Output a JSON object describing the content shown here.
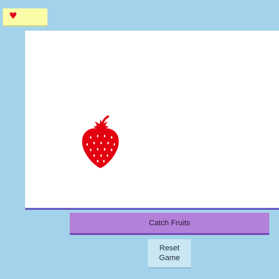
{
  "hud": {
    "lives_icon": "heart-icon",
    "lives_symbol": "♥",
    "lives_color": "#e0001b"
  },
  "play_area": {
    "background": "#ffffff",
    "fruit": {
      "icon": "strawberry-icon",
      "color": "#e3000f"
    }
  },
  "controls": {
    "catch_label": "Catch Fruits",
    "reset_label_line1": "Reset",
    "reset_label_line2": "Game"
  },
  "colors": {
    "page_background": "#a3d3ea",
    "lives_badge": "#fbfca8",
    "catch_button": "#b381d9",
    "reset_button": "#cbe6f3",
    "play_area_border": "#6a64c4"
  }
}
